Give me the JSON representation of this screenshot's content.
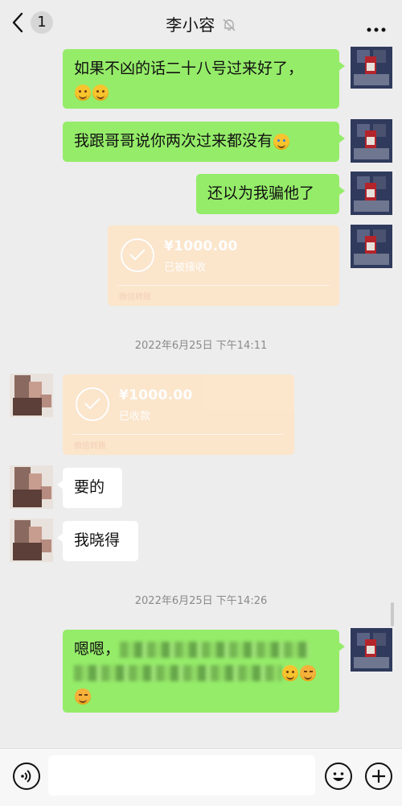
{
  "header": {
    "back_badge": "1",
    "title": "李小容"
  },
  "messages": [
    {
      "side": "me",
      "text": "如果不凶的话二十八号过来好了，"
    },
    {
      "side": "me",
      "text": "我跟哥哥说你两次过来都没有"
    },
    {
      "side": "me",
      "text": "还以为我骗他了"
    },
    {
      "side": "me",
      "type": "transfer",
      "amount": "¥1000.00",
      "status": "已被接收",
      "footer": "微信转账"
    },
    {
      "type": "time",
      "text": "2022年6月25日 下午14:11"
    },
    {
      "side": "her",
      "type": "transfer",
      "amount": "¥1000.00",
      "status": "已收款",
      "footer": "微信转账"
    },
    {
      "side": "her",
      "text": "要的"
    },
    {
      "side": "her",
      "text": "我晓得"
    },
    {
      "type": "time",
      "text": "2022年6月25日 下午14:26"
    },
    {
      "side": "me",
      "text": "嗯嗯，"
    }
  ],
  "bottom": {
    "icons": [
      "voice-icon",
      "emoji-icon",
      "plus-icon"
    ]
  }
}
